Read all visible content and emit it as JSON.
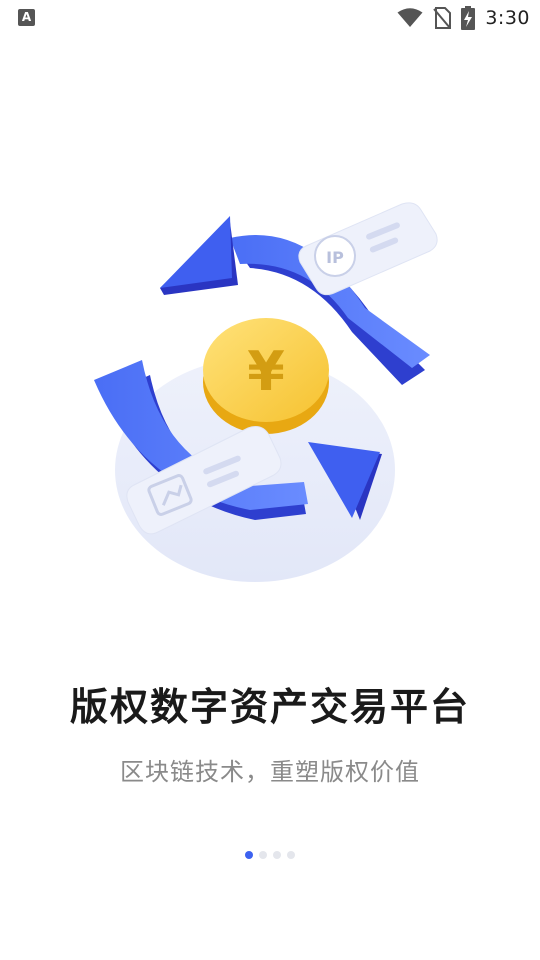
{
  "status_bar": {
    "left_icon_letter": "A",
    "time": "3:30",
    "icons": [
      "wifi-icon",
      "no-sim-icon",
      "battery-charging-icon"
    ]
  },
  "onboarding": {
    "title": "版权数字资产交易平台",
    "subtitle": "区块链技术，重塑版权价值",
    "illustration_labels": {
      "ip_badge": "IP",
      "currency_symbol": "¥"
    },
    "pager": {
      "total": 4,
      "active_index": 0
    }
  },
  "colors": {
    "primary_blue": "#3d62f0",
    "coin_yellow": "#f7c531",
    "title": "#1a1a1a",
    "subtitle": "#8a8a8a"
  }
}
